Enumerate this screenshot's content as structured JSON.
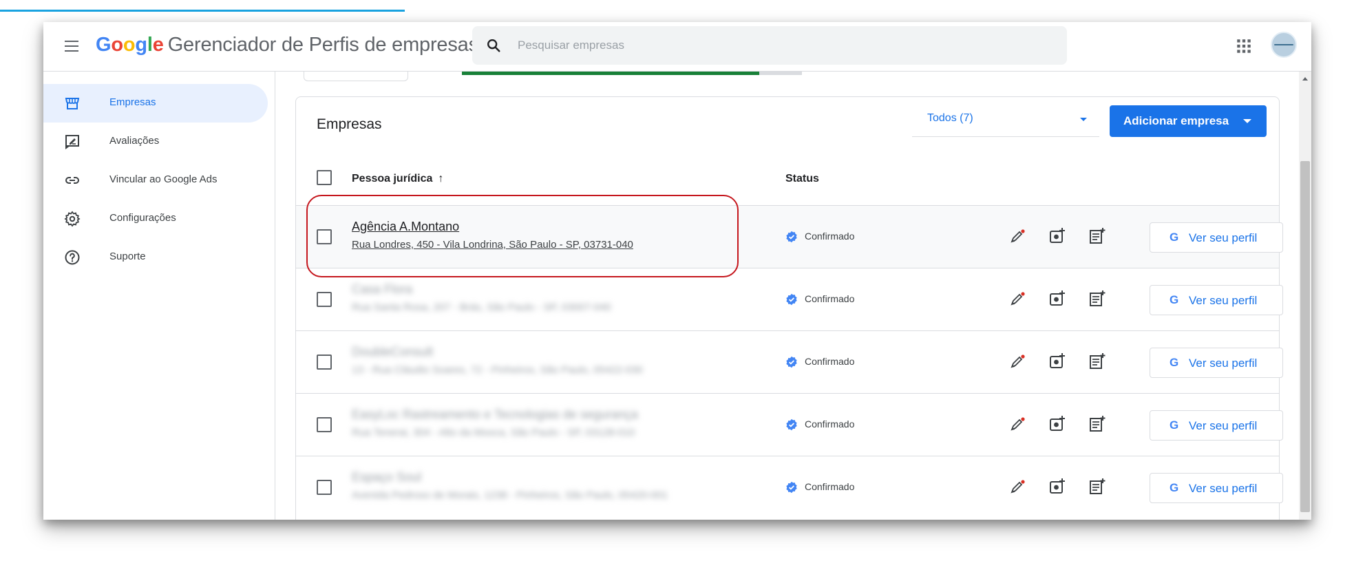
{
  "app": {
    "logo": "Google",
    "title": "Gerenciador de Perfis de empresas"
  },
  "search": {
    "placeholder": "Pesquisar empresas"
  },
  "sidebar": {
    "items": [
      {
        "label": "Empresas",
        "icon": "storefront-icon",
        "active": true
      },
      {
        "label": "Avaliações",
        "icon": "review-icon"
      },
      {
        "label": "Vincular ao Google Ads",
        "icon": "link-icon"
      },
      {
        "label": "Configurações",
        "icon": "gear-icon"
      },
      {
        "label": "Suporte",
        "icon": "help-icon"
      }
    ]
  },
  "card": {
    "title": "Empresas",
    "filter": "Todos (7)",
    "add_button": "Adicionar empresa",
    "columns": {
      "name": "Pessoa jurídica",
      "sort": "↑",
      "status": "Status"
    }
  },
  "rows": [
    {
      "name": "Agência A.Montano",
      "address": "Rua Londres, 450 - Vila Londrina, São Paulo - SP, 03731-040",
      "status": "Confirmado",
      "profile_button": "Ver seu perfil",
      "blurred": false
    },
    {
      "name": "Casa Flora",
      "address": "Rua Santa Rosa, 207 - Brás, São Paulo - SP, 03007-040",
      "status": "Confirmado",
      "profile_button": "Ver seu perfil",
      "blurred": true
    },
    {
      "name": "DoubleConsult",
      "address": "13 - Rua Cláudio Soares, 72 - Pinheiros, São Paulo, 05422-030",
      "status": "Confirmado",
      "profile_button": "Ver seu perfil",
      "blurred": true
    },
    {
      "name": "EasyLoc Rastreamento e Tecnologias de segurança",
      "address": "Rua Tenerai, 304 - Alto da Mooca, São Paulo - SP, 03128-010",
      "status": "Confirmado",
      "profile_button": "Ver seu perfil",
      "blurred": true
    },
    {
      "name": "Espaço Soul",
      "address": "Avenida Pedroso de Morais, 1238 - Pinheiros, São Paulo, 05420-001",
      "status": "Confirmado",
      "profile_button": "Ver seu perfil",
      "blurred": true
    }
  ],
  "colors": {
    "accent": "#1a73e8",
    "highlight": "#c5161d",
    "verified": "#4285f4"
  }
}
